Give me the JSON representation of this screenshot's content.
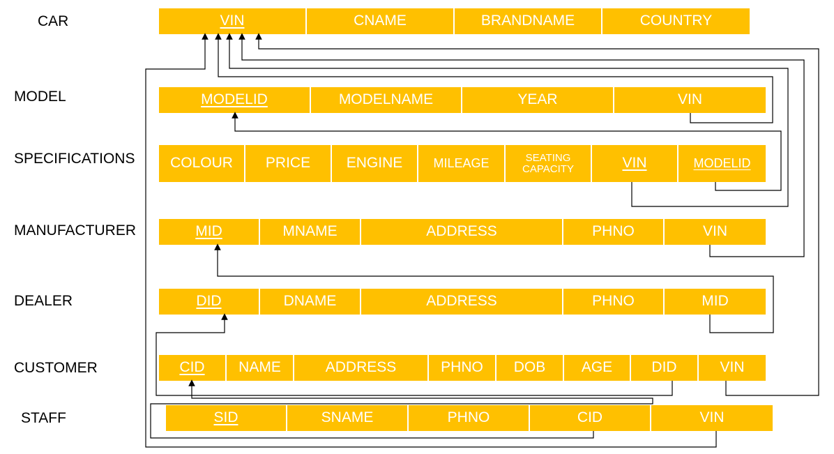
{
  "entities": [
    {
      "key": "car",
      "name": "CAR",
      "columns": [
        {
          "label": "VIN",
          "pk": true
        },
        {
          "label": "CNAME"
        },
        {
          "label": "BRANDNAME"
        },
        {
          "label": "COUNTRY"
        }
      ]
    },
    {
      "key": "model",
      "name": "MODEL",
      "columns": [
        {
          "label": "MODELID",
          "pk": true
        },
        {
          "label": "MODELNAME"
        },
        {
          "label": "YEAR"
        },
        {
          "label": "VIN"
        }
      ]
    },
    {
      "key": "specifications",
      "name": "SPECIFICATIONS",
      "columns": [
        {
          "label": "COLOUR"
        },
        {
          "label": "PRICE"
        },
        {
          "label": "ENGINE"
        },
        {
          "label": "MILEAGE"
        },
        {
          "label": "SEATING CAPACITY"
        },
        {
          "label": "VIN",
          "pk": true
        },
        {
          "label": "MODELID",
          "pk": true
        }
      ]
    },
    {
      "key": "manufacturer",
      "name": "MANUFACTURER",
      "columns": [
        {
          "label": "MID",
          "pk": true
        },
        {
          "label": "MNAME"
        },
        {
          "label": "ADDRESS"
        },
        {
          "label": "PHNO"
        },
        {
          "label": "VIN"
        }
      ]
    },
    {
      "key": "dealer",
      "name": "DEALER",
      "columns": [
        {
          "label": "DID",
          "pk": true
        },
        {
          "label": "DNAME"
        },
        {
          "label": "ADDRESS"
        },
        {
          "label": "PHNO"
        },
        {
          "label": "MID"
        }
      ]
    },
    {
      "key": "customer",
      "name": "CUSTOMER",
      "columns": [
        {
          "label": "CID",
          "pk": true
        },
        {
          "label": "NAME"
        },
        {
          "label": "ADDRESS"
        },
        {
          "label": "PHNO"
        },
        {
          "label": "DOB"
        },
        {
          "label": "AGE"
        },
        {
          "label": "DID"
        },
        {
          "label": "VIN"
        }
      ]
    },
    {
      "key": "staff",
      "name": "STAFF",
      "columns": [
        {
          "label": "SID",
          "pk": true
        },
        {
          "label": "SNAME"
        },
        {
          "label": "PHNO"
        },
        {
          "label": "CID"
        },
        {
          "label": "VIN"
        }
      ]
    }
  ],
  "colors": {
    "cell_fill": "#FFC000",
    "cell_text": "#FFFFFF",
    "line": "#000000"
  }
}
